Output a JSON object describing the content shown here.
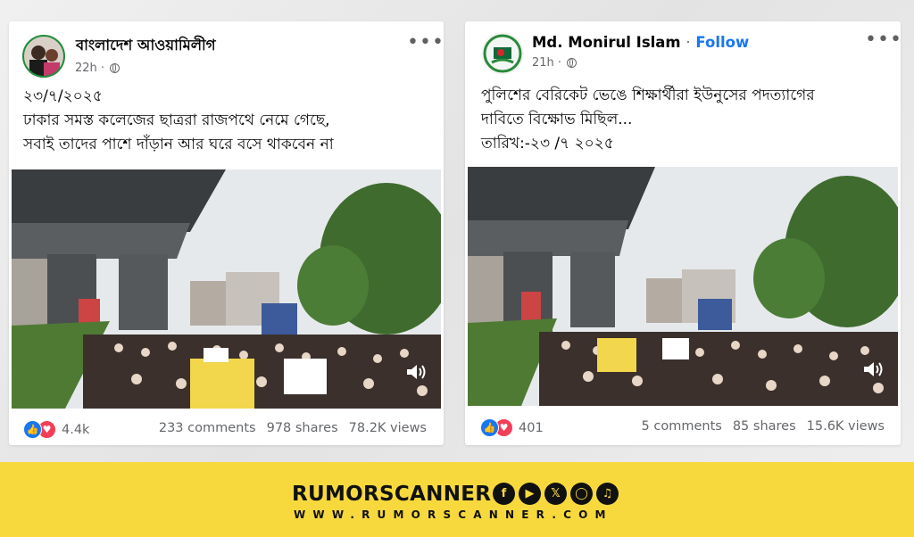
{
  "left_post": {
    "page_name": "বাংলাদেশ আওয়ামিলীগ",
    "time": "22h",
    "more": "•••",
    "date_line": "২৩/৭/২০২৫",
    "text_line1": "ঢাকার সমস্ত কলেজের ছাত্ররা রাজপথে নেমে গেছে,",
    "text_line2": "সবাই তাদের পাশে দাঁড়ান আর ঘরে বসে থাকবেন না",
    "reactions": "4.4k",
    "comments": "233 comments",
    "shares": "978 shares",
    "views": "78.2K views"
  },
  "right_post": {
    "page_name": "Md. Monirul Islam",
    "separator": "·",
    "follow_label": "Follow",
    "time": "21h",
    "more": "•••",
    "text_line1": "পুলিশের বেরিকেট ভেঙে শিক্ষার্থীরা ইউনুসের পদত্যাগের",
    "text_line2": "দাবিতে বিক্ষোভ মিছিল...",
    "date_line": "তারিখ:-২৩ /৭ ২০২৫",
    "reactions": "401",
    "comments": "5 comments",
    "shares": "85 shares",
    "views": "15.6K views"
  },
  "icons": {
    "like": "like-icon",
    "love": "love-icon",
    "globe": "globe-icon",
    "speaker": "speaker-icon"
  },
  "footer": {
    "brand": "RUMORSCANNER",
    "url": "WWW.RUMORSCANNER.COM",
    "socials": [
      "facebook-icon",
      "youtube-icon",
      "x-icon",
      "instagram-icon",
      "tiktok-icon"
    ],
    "colors": {
      "banner": "#f7d93e",
      "text": "#111111"
    }
  },
  "colors": {
    "facebook_blue": "#1877f2",
    "love_red": "#f33e58",
    "meta_grey": "#65676b"
  }
}
